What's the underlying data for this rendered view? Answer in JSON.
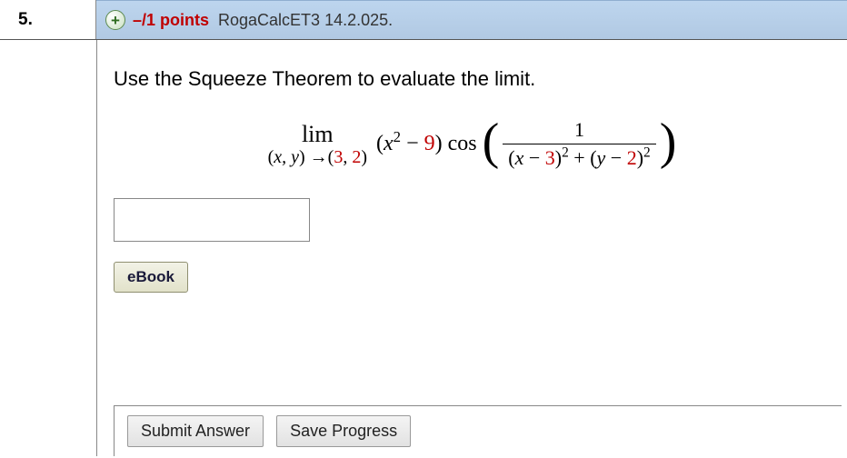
{
  "header": {
    "question_number": "5.",
    "expand_glyph": "+",
    "points_text": "–/1 points",
    "problem_ref": "RogaCalcET3 14.2.025."
  },
  "prompt": "Use the Squeeze Theorem to evaluate the limit.",
  "equation": {
    "lim_word": "lim",
    "lim_sub_prefix": "(",
    "lim_sub_xy": "x, y",
    "lim_sub_arrow": ") →(",
    "lim_sub_a": "3",
    "lim_sub_sep": ", ",
    "lim_sub_b": "2",
    "lim_sub_suffix": ")",
    "factor_pre": "(",
    "factor_x": "x",
    "factor_sq": "2",
    "factor_minus": " − ",
    "factor_nine": "9",
    "factor_post": ") cos",
    "num": "1",
    "den_pre": "(",
    "den_x": "x",
    "den_m1": " − ",
    "den_a": "3",
    "den_paren_sq": ")",
    "den_sq1": "2",
    "den_plus": " + (",
    "den_y": "y",
    "den_m2": " − ",
    "den_b": "2",
    "den_paren_sq2": ")",
    "den_sq2": "2"
  },
  "answer": {
    "value": ""
  },
  "buttons": {
    "ebook": "eBook",
    "submit": "Submit Answer",
    "save": "Save Progress"
  }
}
